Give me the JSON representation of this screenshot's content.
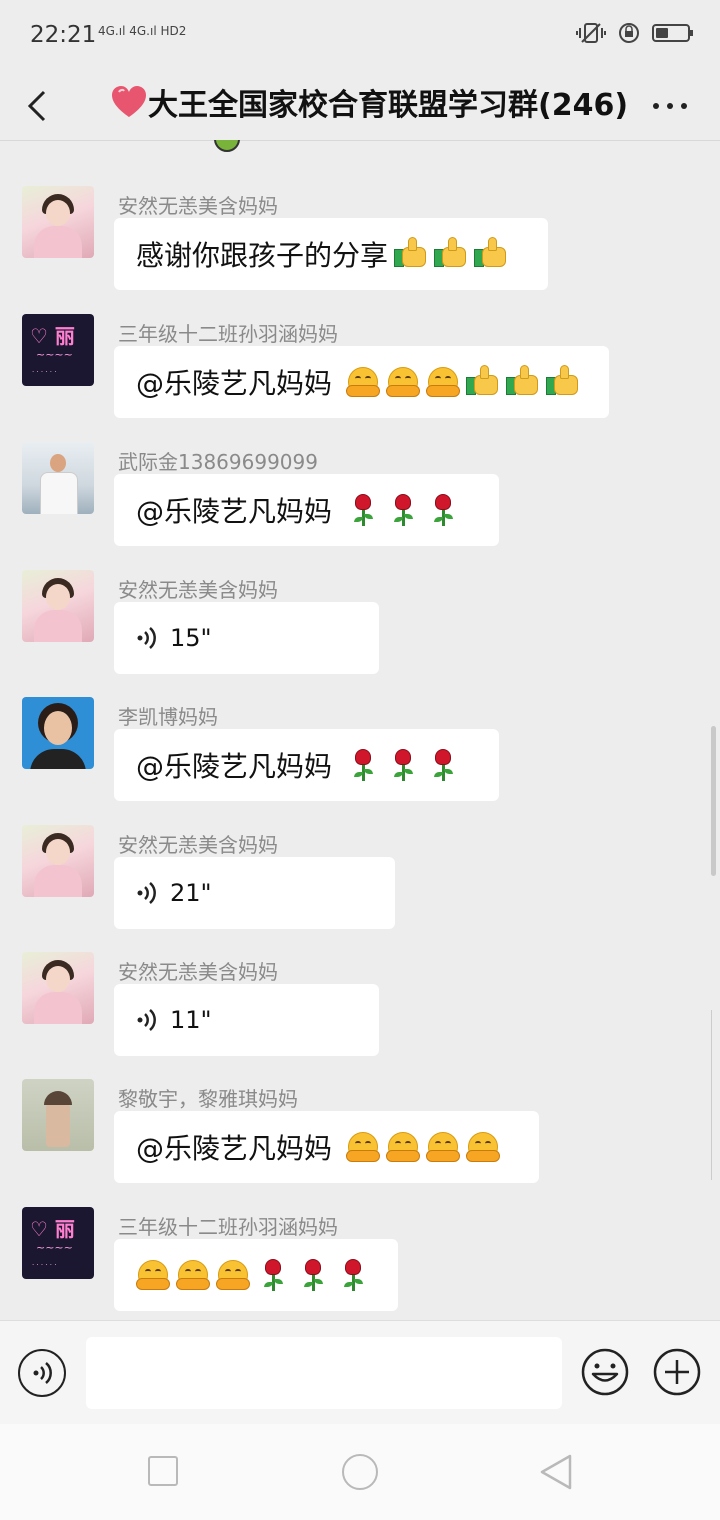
{
  "status_bar": {
    "time": "22:21",
    "network": "4G.ıl 4G.ıl HD2"
  },
  "header": {
    "title": "大王全国家校合育联盟学习群(246)",
    "title_icon": "heart-icon",
    "accent_heart": "#e8556e"
  },
  "messages": [
    {
      "sender": "安然无恙美含妈妈",
      "avatar": "avatar-anran",
      "type": "text",
      "text": "感谢你跟孩子的分享",
      "emojis": [
        "thumbs-up",
        "thumbs-up",
        "thumbs-up"
      ]
    },
    {
      "sender": "三年级十二班孙羽涵妈妈",
      "avatar": "avatar-neon",
      "type": "text",
      "text": "@乐陵艺凡妈妈",
      "emojis": [
        "hug",
        "hug",
        "hug",
        "thumbs-up",
        "thumbs-up",
        "thumbs-up"
      ]
    },
    {
      "sender": "武际金13869699099",
      "avatar": "avatar-wu",
      "type": "text",
      "text": "@乐陵艺凡妈妈",
      "emojis": [
        "rose",
        "rose",
        "rose"
      ]
    },
    {
      "sender": "安然无恙美含妈妈",
      "avatar": "avatar-anran",
      "type": "voice",
      "duration": "15\""
    },
    {
      "sender": "李凯博妈妈",
      "avatar": "avatar-li",
      "type": "text",
      "text": "@乐陵艺凡妈妈",
      "emojis": [
        "rose",
        "rose",
        "rose"
      ]
    },
    {
      "sender": "安然无恙美含妈妈",
      "avatar": "avatar-anran",
      "type": "voice",
      "duration": "21\""
    },
    {
      "sender": "安然无恙美含妈妈",
      "avatar": "avatar-anran",
      "type": "voice",
      "duration": "11\""
    },
    {
      "sender": "黎敬宇，黎雅琪妈妈",
      "avatar": "avatar-lijy",
      "type": "text",
      "text": "@乐陵艺凡妈妈",
      "emojis": [
        "hug",
        "hug",
        "hug",
        "hug"
      ]
    },
    {
      "sender": "三年级十二班孙羽涵妈妈",
      "avatar": "avatar-neon",
      "type": "text",
      "text": "",
      "emojis": [
        "hug",
        "hug",
        "hug",
        "rose",
        "rose",
        "rose"
      ]
    }
  ],
  "neon_avatar": {
    "line1": "♡ 丽"
  },
  "input_bar": {
    "placeholder": ""
  },
  "colors": {
    "background": "#ededed",
    "bubble": "#ffffff",
    "sender": "#8a8a8a"
  }
}
